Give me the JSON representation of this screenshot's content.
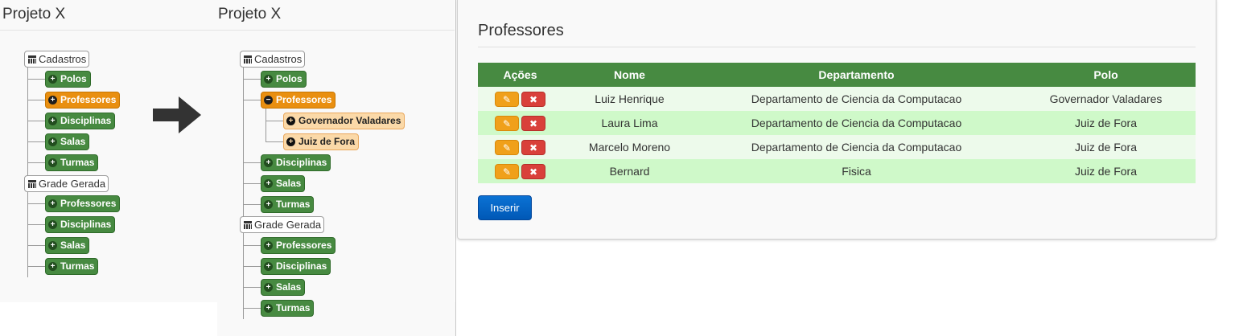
{
  "left_panel": {
    "title": "Projeto X",
    "tree": {
      "cadastros_label": "Cadastros",
      "cadastros_children": [
        "Polos",
        "Professores",
        "Disciplinas",
        "Salas",
        "Turmas"
      ],
      "grade_label": "Grade Gerada",
      "grade_children": [
        "Professores",
        "Disciplinas",
        "Salas",
        "Turmas"
      ]
    }
  },
  "right_panel": {
    "title": "Projeto X",
    "tree": {
      "cadastros_label": "Cadastros",
      "polos": "Polos",
      "professores": "Professores",
      "professores_children": [
        "Governador Valadares",
        "Juiz de Fora"
      ],
      "rest": [
        "Disciplinas",
        "Salas",
        "Turmas"
      ],
      "grade_label": "Grade Gerada",
      "grade_children": [
        "Professores",
        "Disciplinas",
        "Salas",
        "Turmas"
      ]
    }
  },
  "card": {
    "title": "Professores",
    "columns": [
      "Ações",
      "Nome",
      "Departamento",
      "Polo"
    ],
    "rows": [
      {
        "nome": "Luiz Henrique",
        "departamento": "Departamento de Ciencia da Computacao",
        "polo": "Governador Valadares"
      },
      {
        "nome": "Laura Lima",
        "departamento": "Departamento de Ciencia da Computacao",
        "polo": "Juiz de Fora"
      },
      {
        "nome": "Marcelo Moreno",
        "departamento": "Departamento de Ciencia da Computacao",
        "polo": "Juiz de Fora"
      },
      {
        "nome": "Bernard",
        "departamento": "Fisica",
        "polo": "Juiz de Fora"
      }
    ],
    "insert_label": "Inserir"
  },
  "icons": {
    "calendar": "calendar-icon",
    "plus": "plus-circle-icon",
    "minus": "minus-circle-icon",
    "edit": "pencil-icon",
    "delete": "x-icon",
    "arrow": "arrow-right-icon"
  },
  "colors": {
    "green_node": "#478a41",
    "orange_node": "#e98f10",
    "peach_node": "#fbd9a8",
    "table_header": "#478a41",
    "row_light": "#edfaeb",
    "row_dark": "#cff9c9",
    "edit_button": "#f0a01a",
    "delete_button": "#d9403a",
    "insert_button": "#0b72d4"
  }
}
